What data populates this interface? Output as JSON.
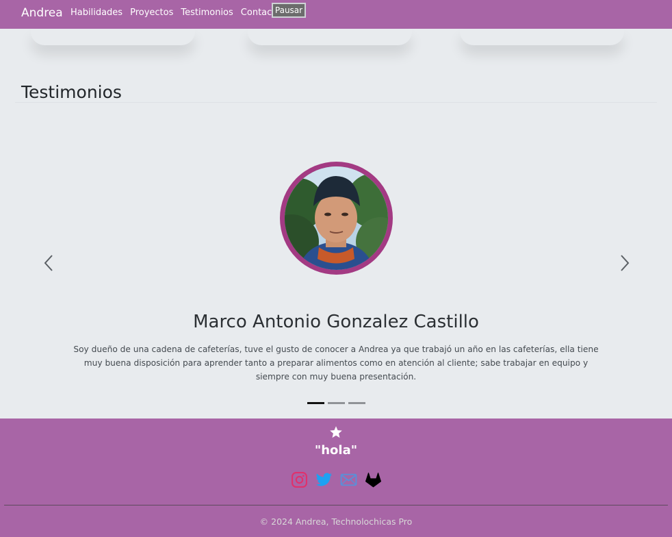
{
  "navbar": {
    "brand": "Andrea",
    "links": [
      "Habilidades",
      "Proyectos",
      "Testimonios",
      "Contacto"
    ],
    "pause_label": "Pausar",
    "background": "#a865a6"
  },
  "section": {
    "title": "Testimonios"
  },
  "carousel": {
    "slide": {
      "name": "Marco Antonio Gonzalez Castillo",
      "quote": "Soy dueño de una cadena de cafeterías, tuve el gusto de conocer a Andrea ya que trabajó un año en las cafeterías, ella tiene muy buena disposición para aprender tanto a preparar alimentos como en atención al cliente; sabe trabajar en equipo y siempre con muy buena presentación.",
      "avatar_border_color": "#a33a83"
    },
    "indicator_count": 3,
    "active_index": 0,
    "prev_icon": "chevron-left-icon",
    "next_icon": "chevron-right-icon"
  },
  "footer": {
    "icon": "star-icon",
    "motto": "\"hola\"",
    "socials": [
      {
        "name": "instagram-icon",
        "color": "#e1306c"
      },
      {
        "name": "twitter-icon",
        "color": "#1da1f2"
      },
      {
        "name": "mail-icon",
        "color": "#5b8fd8"
      },
      {
        "name": "gitlab-icon",
        "color": "#000000"
      }
    ],
    "copyright": "© 2024 Andrea, Technolochicas Pro",
    "background": "#a865a6"
  }
}
